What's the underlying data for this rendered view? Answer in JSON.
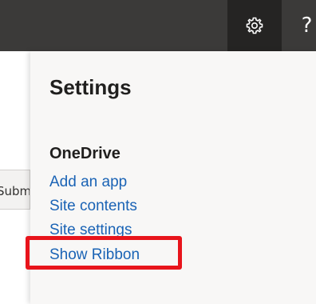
{
  "topbar": {
    "settings_icon": "gear-icon",
    "help_icon": "help-icon",
    "help_glyph": "?"
  },
  "background_page": {
    "partial_button_text": "Submiss"
  },
  "settings_panel": {
    "title": "Settings",
    "section_heading": "OneDrive",
    "links": [
      "Add an app",
      "Site contents",
      "Site settings",
      "Show Ribbon"
    ]
  },
  "colors": {
    "topbar": "#3b3a39",
    "gear_active": "#252423",
    "link": "#1a63b5",
    "highlight": "#e8141b",
    "panel_bg": "#f8f7f6"
  }
}
